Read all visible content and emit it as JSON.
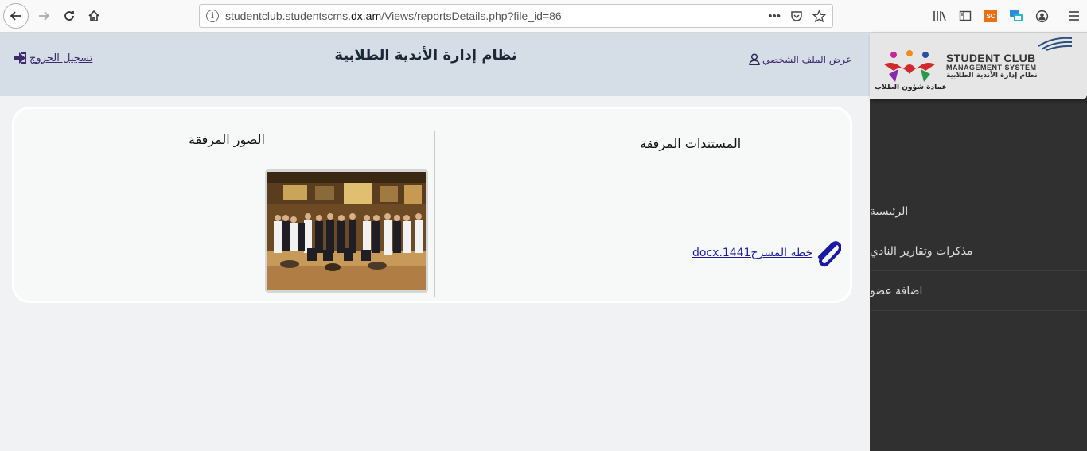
{
  "browser": {
    "url_prefix": "studentclub.studentscms.",
    "url_domain": "dx.am",
    "url_path": "/Views/reportsDetails.php?file_id=86",
    "sc_badge": "SC"
  },
  "header": {
    "title": "نظام إدارة الأندية الطلابية",
    "logout_label": "تسجيل الخروج",
    "profile_label": "عرض الملف الشخصي"
  },
  "logo": {
    "line1": "STUDENT CLUB",
    "line2": "MANAGEMENT SYSTEM",
    "line3": "نظام إدارة الأندية الطلابية",
    "line4": "عمادة شؤون الطلاب"
  },
  "sidebar": {
    "items": [
      {
        "label": "الرئيسية"
      },
      {
        "label": "مذكرات وتقارير النادي"
      },
      {
        "label": "اضافة عضو"
      }
    ]
  },
  "content": {
    "docs_title": "المستندات المرفقة",
    "images_title": "الصور المرفقة",
    "attachment_name": "خطة المسرح1441.docx"
  },
  "colors": {
    "header_bg": "#d5dde6",
    "sidebar_bg": "#303030",
    "link": "#3d2a6e",
    "attachment_link": "#1a1aa6"
  }
}
